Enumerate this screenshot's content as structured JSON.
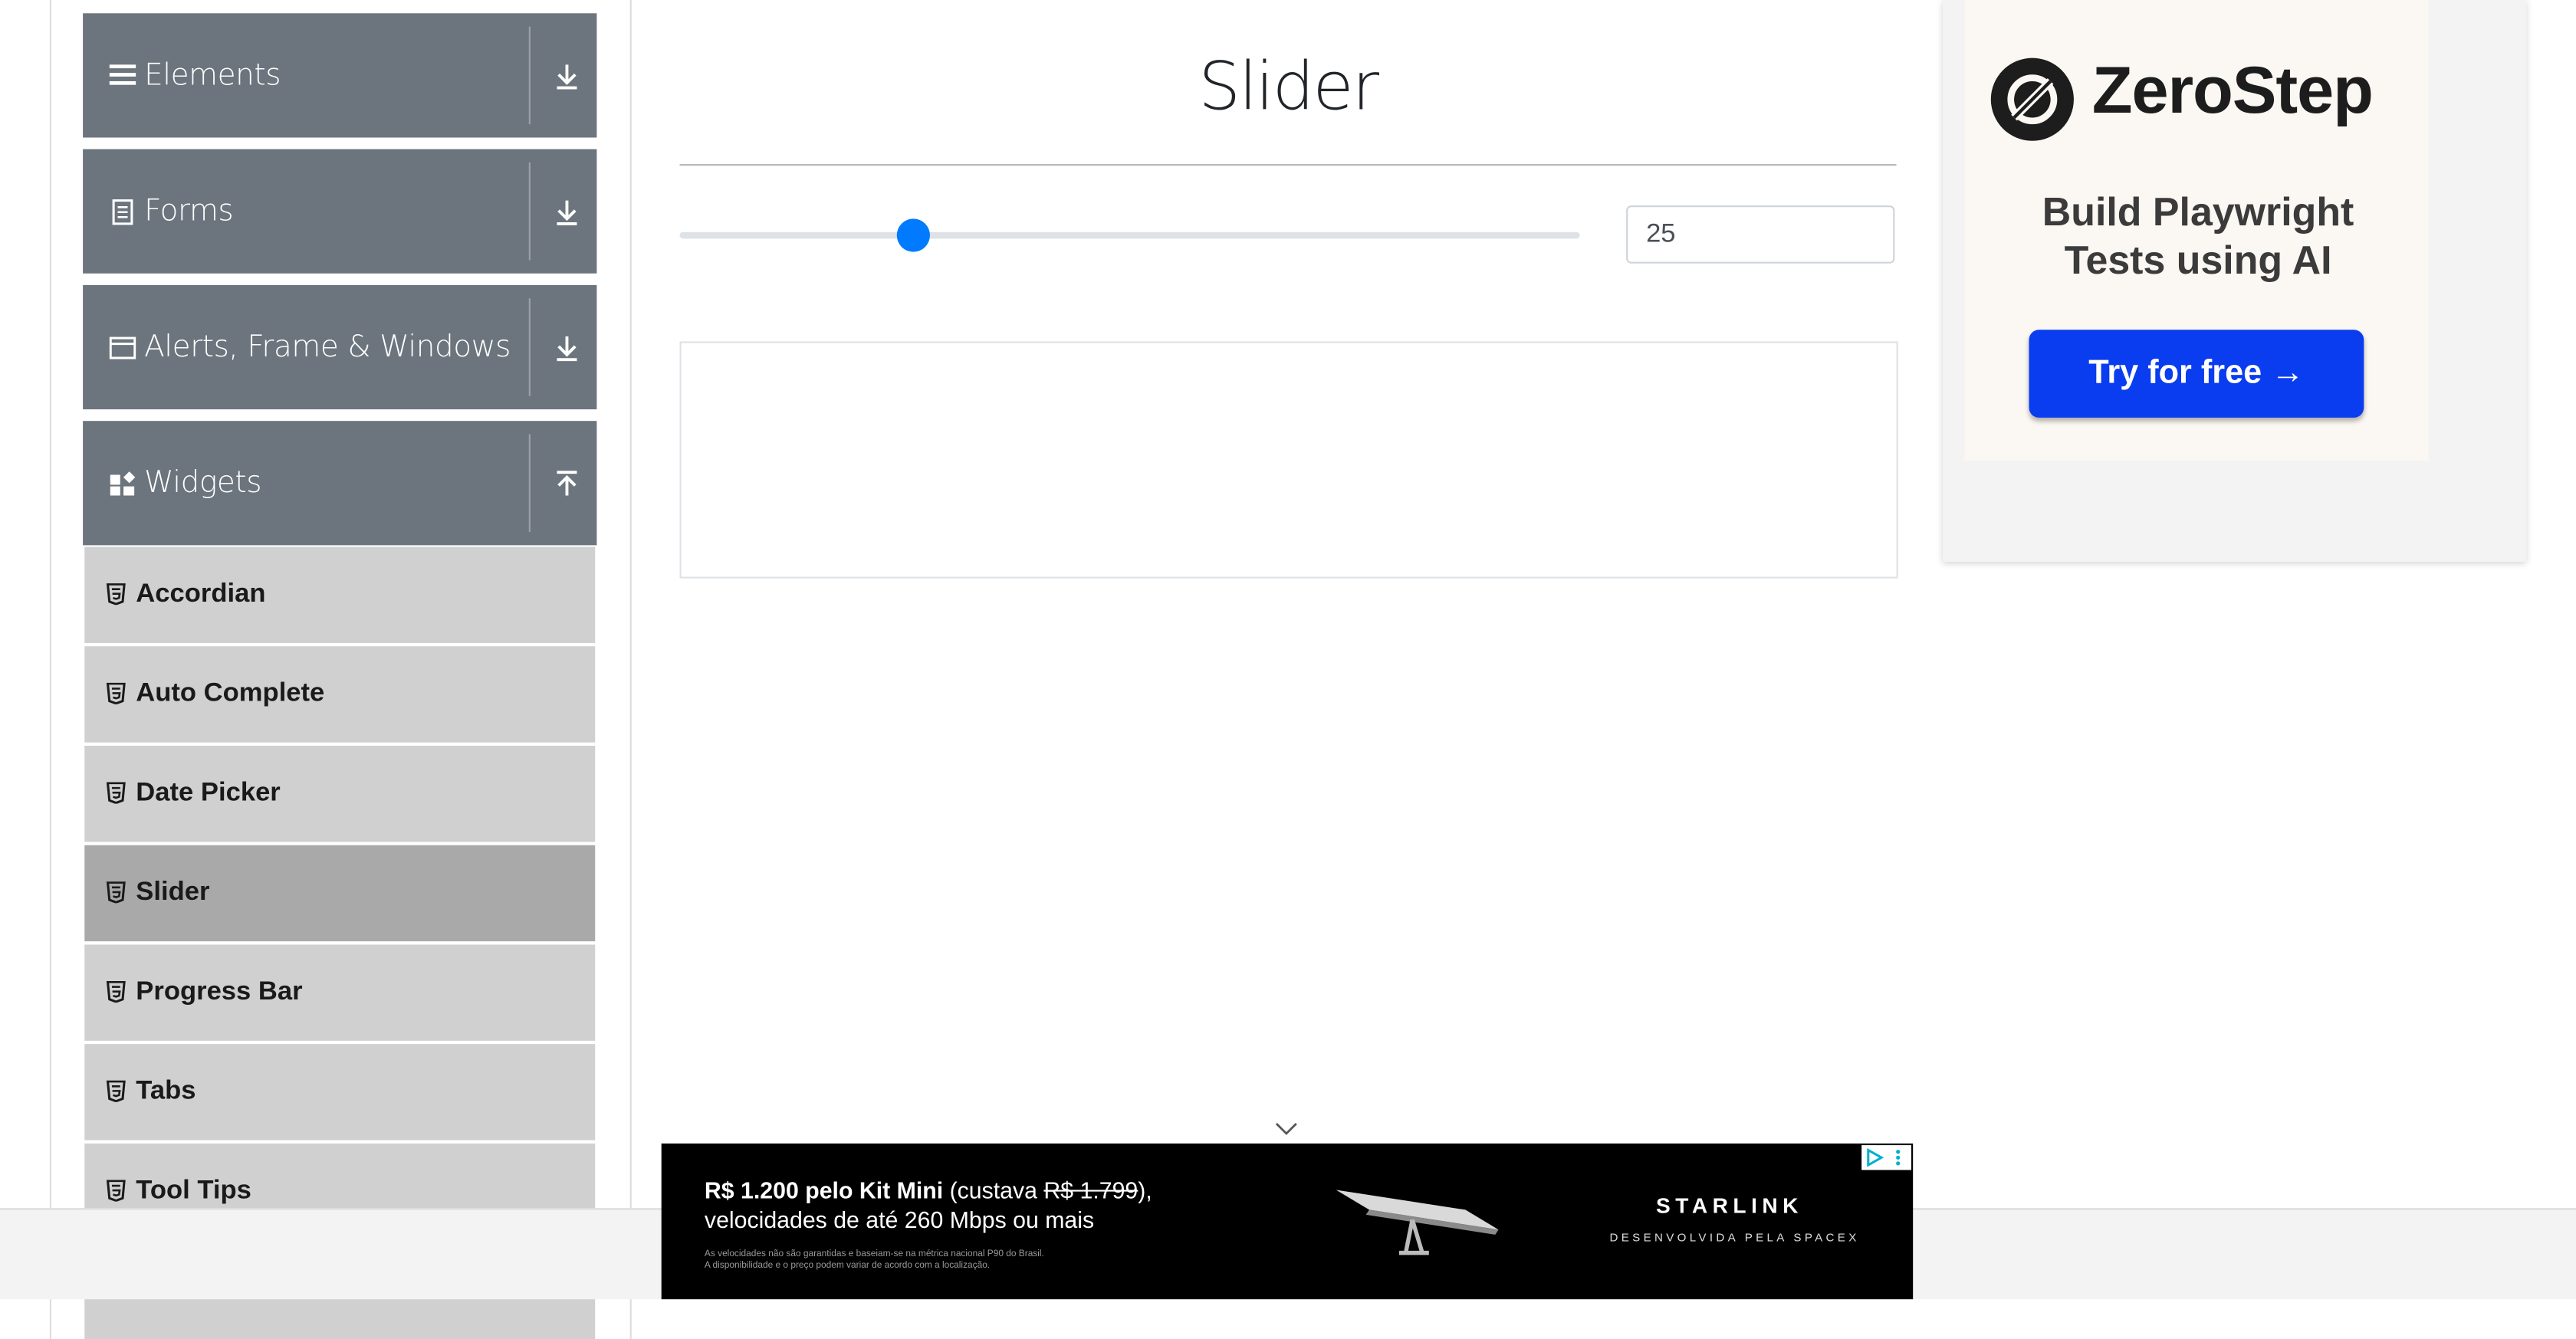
{
  "sidebar": {
    "groups": [
      {
        "label": "Elements",
        "icon": "hamburger-icon"
      },
      {
        "label": "Forms",
        "icon": "document-icon"
      },
      {
        "label": "Alerts, Frame & Windows",
        "icon": "window-icon"
      },
      {
        "label": "Widgets",
        "icon": "widgets-icon"
      }
    ],
    "items": [
      {
        "label": "Accordian"
      },
      {
        "label": "Auto Complete"
      },
      {
        "label": "Date Picker"
      },
      {
        "label": "Slider",
        "active": true
      },
      {
        "label": "Progress Bar"
      },
      {
        "label": "Tabs"
      },
      {
        "label": "Tool Tips"
      }
    ]
  },
  "main": {
    "title": "Slider",
    "slider": {
      "value": 25,
      "min": 0,
      "max": 100,
      "accent": "#007bff"
    },
    "slider_value_display": "25"
  },
  "ads": {
    "zerostep": {
      "brand": "ZeroStep",
      "tagline_line1": "Build Playwright",
      "tagline_line2": "Tests using AI",
      "cta": "Try for free →",
      "cta_color": "#0a3cf0"
    },
    "starlink": {
      "headline_bold": "R$ 1.200 pelo Kit Mini",
      "headline_mid": " (custava ",
      "headline_strike": "R$ 1.799",
      "headline_end": "),",
      "line2": "velocidades de até 260 Mbps ou mais",
      "fine1": "As velocidades não são garantidas e baseiam-se na métrica nacional P90 do Brasil.",
      "fine2": "A disponibilidade e o preço podem variar de acordo com a localização.",
      "brand": "STARLINK",
      "sub": "DESENVOLVIDA PELA SPACEX"
    }
  }
}
